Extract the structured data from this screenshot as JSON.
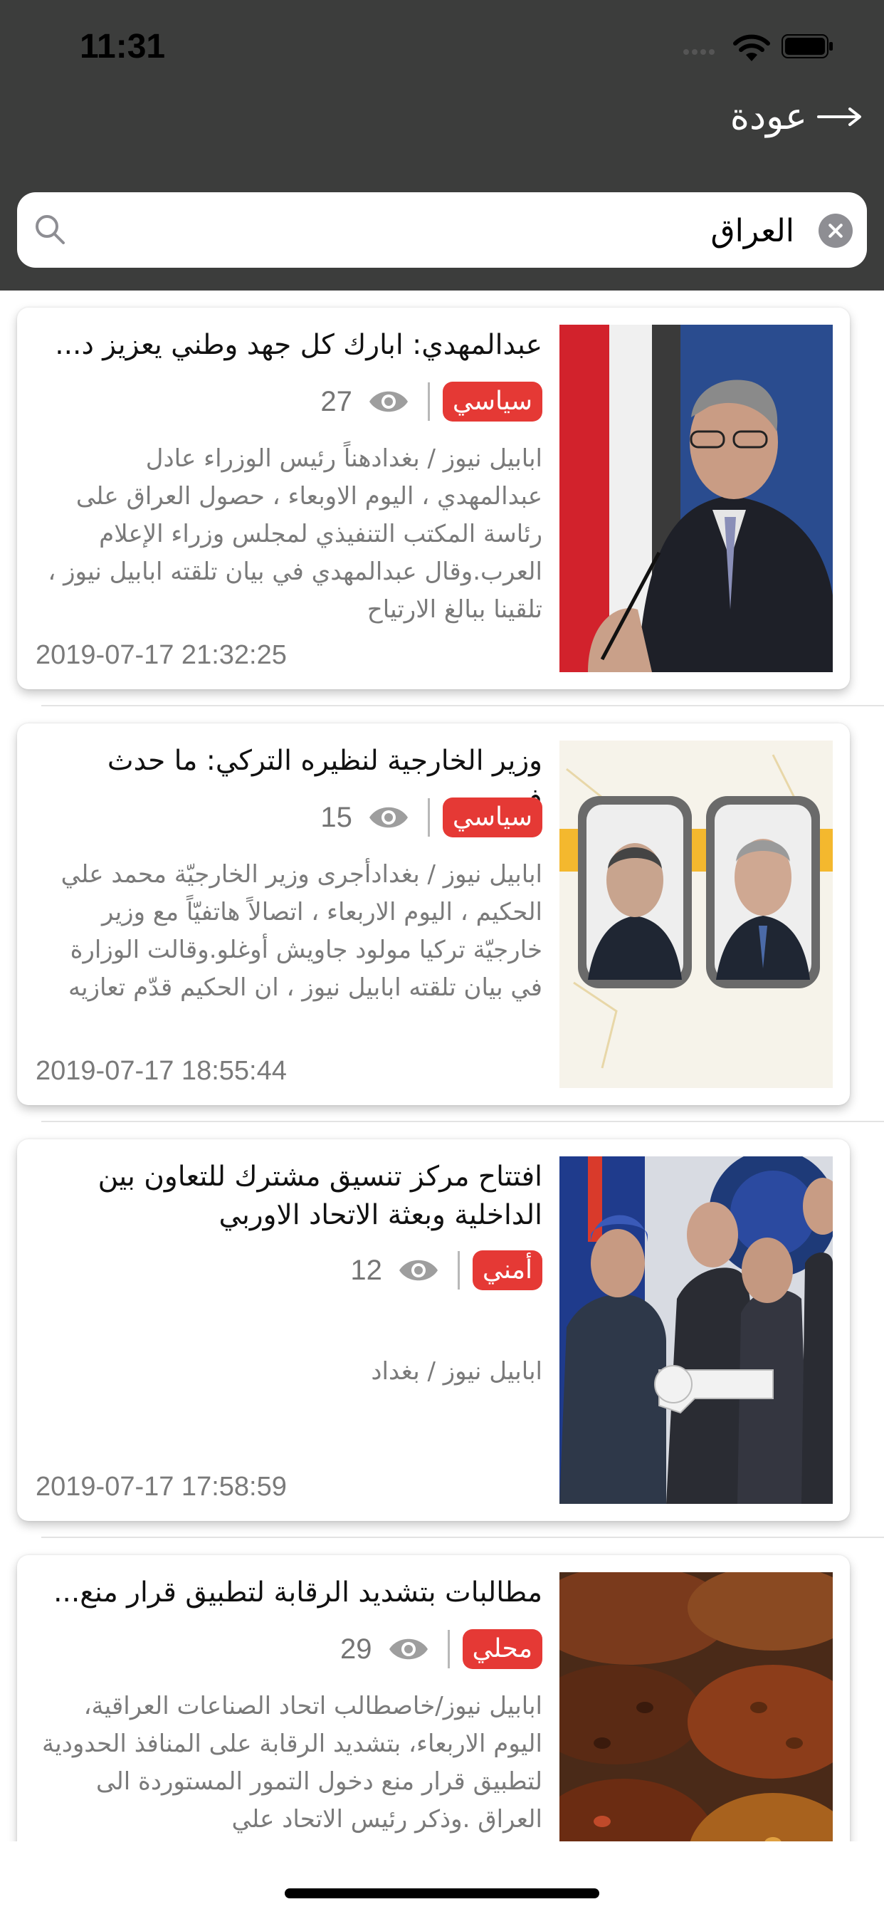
{
  "status_bar": {
    "time": "11:31"
  },
  "nav": {
    "back_label": "عودة"
  },
  "search": {
    "value": "العراق"
  },
  "articles": [
    {
      "title": "عبدالمهدي: ابارك كل جهد وطني يعزيز د...",
      "category": "سياسي",
      "views": "27",
      "excerpt": "ابابيل نيوز / بغدادهناً رئيس الوزراء عادل عبدالمهدي ، اليوم الاوبعاء ، حصول العراق على رئاسة المكتب التنفيذي لمجلس وزراء الإعلام العرب.وقال عبدالمهدي في بيان تلقته ابابيل نيوز ، تلقينا ببالغ الارتياح",
      "timestamp": "2019-07-17 21:32:25",
      "image": "politician-at-microphone-photo"
    },
    {
      "title": "وزير الخارجية لنظيره التركي: ما حدث ف...",
      "category": "سياسي",
      "views": "15",
      "excerpt": "ابابيل نيوز / بغدادأجرى وزير الخارجيّة محمد علي الحكيم ، اليوم الاربعاء ، اتصالاً هاتفيّاً مع وزير خارجيّة تركيا مولود جاويش أوغلو.وقالت الوزارة في بيان تلقته ابابيل نيوز ، ان الحكيم قدّم تعازيه",
      "timestamp": "2019-07-17 18:55:44",
      "image": "two-ministers-portraits-photo"
    },
    {
      "title": "افتتاح مركز تنسيق مشترك للتعاون بين الداخلية وبعثة الاتحاد الاوربي",
      "category": "أمني",
      "views": "12",
      "excerpt": "ابابيل نيوز / بغداد",
      "timestamp": "2019-07-17 17:58:59",
      "image": "key-handover-ceremony-photo"
    },
    {
      "title": "مطالبات بتشديد الرقابة لتطبيق قرار منع...",
      "category": "محلي",
      "views": "29",
      "excerpt": "ابابيل نيوز/خاصطالب اتحاد الصناعات العراقية، اليوم الاربعاء، بتشديد الرقابة على المنافذ الحدودية لتطبيق قرار منع دخول التمور المستوردة الى العراق .وذكر رئيس الاتحاد علي",
      "timestamp": "",
      "image": "dates-in-bowls-photo"
    }
  ],
  "colors": {
    "nav_background": "#3c3d3c",
    "category_badge": "#e53935",
    "meta_text": "#757575"
  }
}
